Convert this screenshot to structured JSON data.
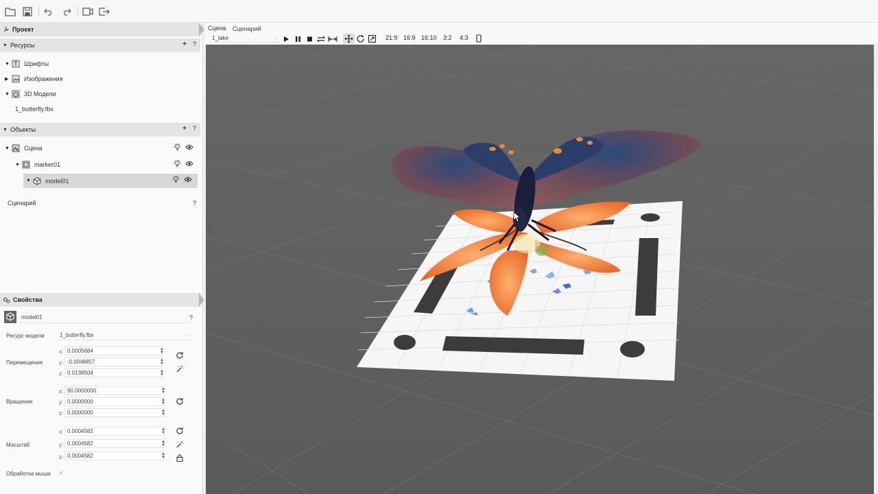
{
  "toolbar": {
    "icons": [
      "folder-open-icon",
      "save-icon",
      "undo-icon",
      "redo-icon",
      "preview-icon",
      "export-icon"
    ]
  },
  "project": {
    "title": "Проект"
  },
  "resources": {
    "title": "Ресурсы",
    "add": "+",
    "help": "?",
    "items": [
      {
        "label": "Шрифты"
      },
      {
        "label": "Изображения"
      },
      {
        "label": "3D Модели"
      }
    ],
    "child": "1_butterfly.fbx"
  },
  "objects": {
    "title": "Объекты",
    "add": "+",
    "help": "?",
    "items": [
      {
        "label": "Сцена"
      },
      {
        "label": "marker01"
      },
      {
        "label": "model01"
      }
    ]
  },
  "scenario": {
    "label": "Сценарий",
    "help": "?"
  },
  "properties": {
    "title": "Свойства",
    "name_value": "model01",
    "help": "?",
    "model_resource_label": "Ресурс модели",
    "model_resource_value": "1_butterfly.fbx",
    "position_label": "Перемещение",
    "rotation_label": "Вращение",
    "scale_label": "Масштаб",
    "axes": [
      "x:",
      "y:",
      "z:"
    ],
    "position": [
      "0.0005684",
      "-0.0048857",
      "0.0138504"
    ],
    "rotation": [
      "90.0000000",
      "0.0000000",
      "0.0000000"
    ],
    "scale": [
      "0.0004582",
      "0.0004582",
      "0.0004582"
    ],
    "mouse_label": "Обработка мыши",
    "mouse_checked": "✓"
  },
  "viewport": {
    "tabs": [
      "Сцена",
      "Сценарий"
    ],
    "take": "1_take",
    "aspects": [
      "21:9",
      "16:9",
      "16:10",
      "3:2",
      "4:3"
    ]
  }
}
